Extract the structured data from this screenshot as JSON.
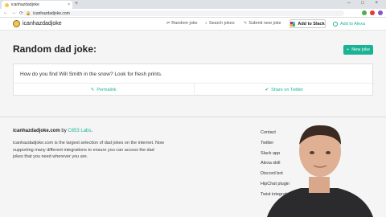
{
  "browser": {
    "tab_title": "icanhazdadjoke",
    "url": "icanhazdadjoke.com",
    "new_tab_glyph": "+",
    "close_glyph": "×",
    "window_controls": "– □ ×",
    "back_glyph": "←",
    "forward_glyph": "→",
    "reload_glyph": "⟳",
    "lock_glyph": "🔒"
  },
  "header": {
    "brand": "icanhazdadjoke",
    "nav": [
      {
        "label": "Random joke",
        "icon": "shuffle-icon",
        "glyph": "⇄"
      },
      {
        "label": "Search jokes",
        "icon": "search-icon",
        "glyph": "⌕"
      },
      {
        "label": "Submit new joke",
        "icon": "pencil-icon",
        "glyph": "✎"
      }
    ],
    "slack_button": "Add to Slack",
    "alexa_button": "Add to Alexa"
  },
  "main": {
    "title": "Random dad joke:",
    "new_joke_button": "New joke",
    "new_joke_glyph": "+",
    "joke_text": "How do you find Will Smith in the snow? Look for fresh prints.",
    "permalink": "Permalink",
    "permalink_glyph": "✎",
    "share": "Share on Twitter",
    "share_glyph": "✔"
  },
  "footer": {
    "site": "icanhazdadjoke.com",
    "by": "by",
    "lab": "C653 Labs",
    "period": ".",
    "description": "icanhazdadjoke.com is the largest selection of dad jokes on the internet. Now supporting many different integrations to ensure you can access the dad jokes that you need wherever you are.",
    "links": [
      "Contact",
      "Twitter",
      "Slack app",
      "Alexa skill",
      "Discord bot",
      "HipChat plugin",
      "Twist integration"
    ]
  },
  "colors": {
    "accent": "#1ab394",
    "background": "#f5f5f5"
  }
}
